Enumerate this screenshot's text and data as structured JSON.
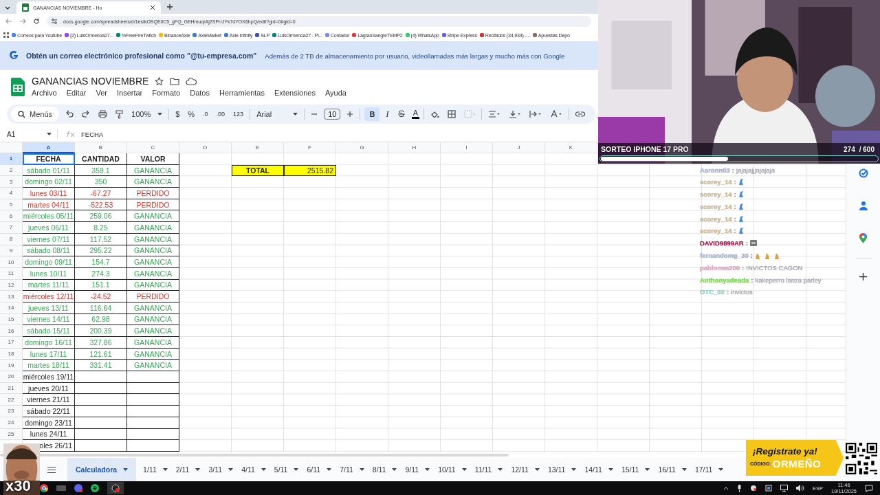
{
  "browser": {
    "tab_title": "GANANCIAS NOVIEMBRE - Ho",
    "url": "docs.google.com/spreadsheets/d/1esIkOSQEiIC5_gFQ_GEHmuqrAj2SPrrJYk7dYOX6hpQ/edit?gid=0#gid=0",
    "bookmarks": [
      {
        "label": "Correos para Youtube",
        "color": "#4285f4"
      },
      {
        "label": "(2) LuisOrmenoa27...",
        "color": "#9146ff"
      },
      {
        "label": "%FreeFireTwitch",
        "color": "#00897b"
      },
      {
        "label": "BinanceAxie",
        "color": "#f0b90b"
      },
      {
        "label": "AxieMarket",
        "color": "#3b82c4"
      },
      {
        "label": "Axie Infinity",
        "color": "#3b82c4"
      },
      {
        "label": "SLP",
        "color": "#3f51b5"
      },
      {
        "label": "LuisOrmenoa27 - Pl...",
        "color": "#00897b"
      },
      {
        "label": "Contador",
        "color": "#7e8ce0"
      },
      {
        "label": "LagranSangreTEMP2",
        "color": "#e53935"
      },
      {
        "label": "(4) WhatsApp",
        "color": "#25d366"
      },
      {
        "label": "Stripe Express",
        "color": "#635bff"
      },
      {
        "label": "Recibidos (34,934) -...",
        "color": "#d93025"
      },
      {
        "label": "Apuestas Depo",
        "color": "#8d6e63"
      }
    ]
  },
  "banner": {
    "headline": "Obtén un correo electrónico profesional como \"@tu-empresa.com\"",
    "detail": "Además de 2 TB de almacenamiento por usuario, videollamadas más largas y mucho más con Google"
  },
  "document": {
    "title": "GANANCIAS NOVIEMBRE",
    "menu": [
      "Archivo",
      "Editar",
      "Ver",
      "Insertar",
      "Formato",
      "Datos",
      "Herramientas",
      "Extensiones",
      "Ayuda"
    ]
  },
  "toolbar": {
    "search": "Menús",
    "zoom": "100%",
    "currency": "$",
    "percent": "%",
    "decrease_decimals": ".0",
    "increase_decimals": ".00",
    "number_format": "123",
    "font": "Arial",
    "font_size": "10",
    "bold_label": "B",
    "bold": true,
    "italic_label": "I",
    "text_color_label": "A"
  },
  "formula_bar": {
    "cell": "A1",
    "formula": "FECHA"
  },
  "columns": [
    {
      "label": "A",
      "selected": true
    },
    {
      "label": "B",
      "selected": false
    },
    {
      "label": "C",
      "selected": false
    },
    {
      "label": "D",
      "selected": false
    },
    {
      "label": "E",
      "selected": false
    },
    {
      "label": "F",
      "selected": false
    },
    {
      "label": "G",
      "selected": false
    },
    {
      "label": "H",
      "selected": false
    },
    {
      "label": "I",
      "selected": false
    },
    {
      "label": "J",
      "selected": false
    },
    {
      "label": "K",
      "selected": false
    }
  ],
  "total": {
    "label": "TOTAL",
    "value": "2515.82"
  },
  "rows": [
    {
      "number": "1",
      "fecha": "FECHA",
      "cantidad": "CANTIDAD",
      "valor": "VALOR",
      "kind": "header"
    },
    {
      "number": "2",
      "fecha": "sábado 01/11",
      "cantidad": "359.1",
      "valor": "GANANCIA",
      "kind": "gain"
    },
    {
      "number": "3",
      "fecha": "domingo 02/11",
      "cantidad": "350",
      "valor": "GANANCIA",
      "kind": "gain"
    },
    {
      "number": "4",
      "fecha": "lunes 03/11",
      "cantidad": "-67.27",
      "valor": "PERDIDO",
      "kind": "loss"
    },
    {
      "number": "5",
      "fecha": "martes 04/11",
      "cantidad": "-522.53",
      "valor": "PERDIDO",
      "kind": "loss"
    },
    {
      "number": "6",
      "fecha": "miércoles 05/11",
      "cantidad": "259.06",
      "valor": "GANANCIA",
      "kind": "gain"
    },
    {
      "number": "7",
      "fecha": "jueves 06/11",
      "cantidad": "8.25",
      "valor": "GANANCIA",
      "kind": "gain"
    },
    {
      "number": "8",
      "fecha": "viernes 07/11",
      "cantidad": "117.52",
      "valor": "GANANCIA",
      "kind": "gain"
    },
    {
      "number": "9",
      "fecha": "sábado 08/11",
      "cantidad": "295.22",
      "valor": "GANANCIA",
      "kind": "gain"
    },
    {
      "number": "10",
      "fecha": "domingo 09/11",
      "cantidad": "154.7",
      "valor": "GANANCIA",
      "kind": "gain"
    },
    {
      "number": "11",
      "fecha": "lunes 10/11",
      "cantidad": "274.3",
      "valor": "GANANCIA",
      "kind": "gain"
    },
    {
      "number": "12",
      "fecha": "martes 11/11",
      "cantidad": "151.1",
      "valor": "GANANCIA",
      "kind": "gain"
    },
    {
      "number": "13",
      "fecha": "miércoles 12/11",
      "cantidad": "-24.52",
      "valor": "PERDIDO",
      "kind": "loss"
    },
    {
      "number": "14",
      "fecha": "jueves 13/11",
      "cantidad": "116.64",
      "valor": "GANANCIA",
      "kind": "gain"
    },
    {
      "number": "15",
      "fecha": "viernes 14/11",
      "cantidad": "62.98",
      "valor": "GANANCIA",
      "kind": "gain"
    },
    {
      "number": "16",
      "fecha": "sábado 15/11",
      "cantidad": "200.39",
      "valor": "GANANCIA",
      "kind": "gain"
    },
    {
      "number": "17",
      "fecha": "domingo 16/11",
      "cantidad": "327.86",
      "valor": "GANANCIA",
      "kind": "gain"
    },
    {
      "number": "18",
      "fecha": "lunes 17/11",
      "cantidad": "121.61",
      "valor": "GANANCIA",
      "kind": "gain"
    },
    {
      "number": "19",
      "fecha": "martes 18/11",
      "cantidad": "331.41",
      "valor": "GANANCIA",
      "kind": "gain"
    },
    {
      "number": "20",
      "fecha": "miércoles 19/11",
      "kind": "date"
    },
    {
      "number": "21",
      "fecha": "jueves 20/11",
      "kind": "date"
    },
    {
      "number": "22",
      "fecha": "viernes 21/11",
      "kind": "date"
    },
    {
      "number": "23",
      "fecha": "sábado 22/11",
      "kind": "date"
    },
    {
      "number": "24",
      "fecha": "domingo 23/11",
      "kind": "date"
    },
    {
      "number": "25",
      "fecha": "lunes 24/11",
      "kind": "date"
    },
    {
      "fecha": "oles 26/11",
      "kind": "date"
    }
  ],
  "sheet_tabs": [
    {
      "label": "Calculadora",
      "selected": true
    },
    {
      "label": "1/11",
      "selected": false
    },
    {
      "label": "2/11",
      "selected": false
    },
    {
      "label": "3/11",
      "selected": false
    },
    {
      "label": "4/11",
      "selected": false
    },
    {
      "label": "5/11",
      "selected": false
    },
    {
      "label": "6/11",
      "selected": false
    },
    {
      "label": "7/11",
      "selected": false
    },
    {
      "label": "8/11",
      "selected": false
    },
    {
      "label": "9/11",
      "selected": false
    },
    {
      "label": "10/11",
      "selected": false
    },
    {
      "label": "11/11",
      "selected": false
    },
    {
      "label": "12/11",
      "selected": false
    },
    {
      "label": "13/11",
      "selected": false
    },
    {
      "label": "14/11",
      "selected": false
    },
    {
      "label": "15/11",
      "selected": false
    },
    {
      "label": "16/11",
      "selected": false
    },
    {
      "label": "17/11",
      "selected": false
    }
  ],
  "stream": {
    "giveaway": {
      "title": "SORTEO IPHONE 17 PRO",
      "count": "274",
      "goal": "/ 600",
      "level": 0.46
    },
    "chat": [
      {
        "user": "Aaronn03",
        "color": "#aab4d8",
        "separator": ":",
        "kind": "text",
        "message": "jajajajjjajajaja"
      },
      {
        "user": "scorey_14",
        "color": "#d8bc8e",
        "separator": ":",
        "kind": "emote"
      },
      {
        "user": "scorey_14",
        "color": "#d8bc8e",
        "separator": ":",
        "kind": "emote"
      },
      {
        "user": "scorey_14",
        "color": "#d8bc8e",
        "separator": ":",
        "kind": "emote"
      },
      {
        "user": "scorey_14",
        "color": "#d8bc8e",
        "separator": ":",
        "kind": "emote"
      },
      {
        "user": "scorey_14",
        "color": "#d8bc8e",
        "separator": ":",
        "kind": "emote"
      },
      {
        "user": "DAVID9899AR",
        "color": "#b0104a",
        "separator": ":",
        "kind": "sticker"
      },
      {
        "user": "fernandomg_30",
        "color": "#a9bad6",
        "separator": ":",
        "kind": "emotes"
      },
      {
        "user": "pablomm200",
        "color": "#e0a8c0",
        "separator": ":",
        "kind": "text",
        "message": "INVICTOS CAGON"
      },
      {
        "user": "Anthonyadeada",
        "color": "#7be04a",
        "separator": ":",
        "kind": "text",
        "message": "kakeperro lanza parley"
      },
      {
        "user": "OTC_02",
        "color": "#8fd8c8",
        "separator": ":",
        "kind": "text",
        "message": "invictos"
      }
    ],
    "promo": {
      "headline": "¡Registrate ya!",
      "code_label": "CÓDIGO:",
      "code": "ORMEÑO"
    },
    "meme": {
      "multiplier": "x30"
    }
  },
  "taskbar": {
    "language": "ESP",
    "time": "11:46",
    "date": "19/11/2025"
  }
}
